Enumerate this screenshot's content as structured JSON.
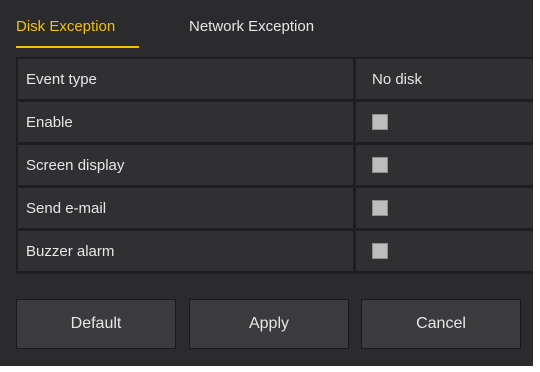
{
  "tabs": {
    "disk": "Disk Exception",
    "network": "Network Exception"
  },
  "rows": [
    {
      "label": "Event type",
      "value": "No disk"
    },
    {
      "label": "Enable",
      "checked": false
    },
    {
      "label": "Screen display",
      "checked": false
    },
    {
      "label": "Send e-mail",
      "checked": false
    },
    {
      "label": "Buzzer alarm",
      "checked": false
    }
  ],
  "buttons": {
    "default": "Default",
    "apply": "Apply",
    "cancel": "Cancel"
  },
  "colors": {
    "panel_background": "#2b2b2d",
    "active_tab": "#f2c200",
    "text": "#e6e6e6",
    "checkbox": "#bdbdbd"
  }
}
